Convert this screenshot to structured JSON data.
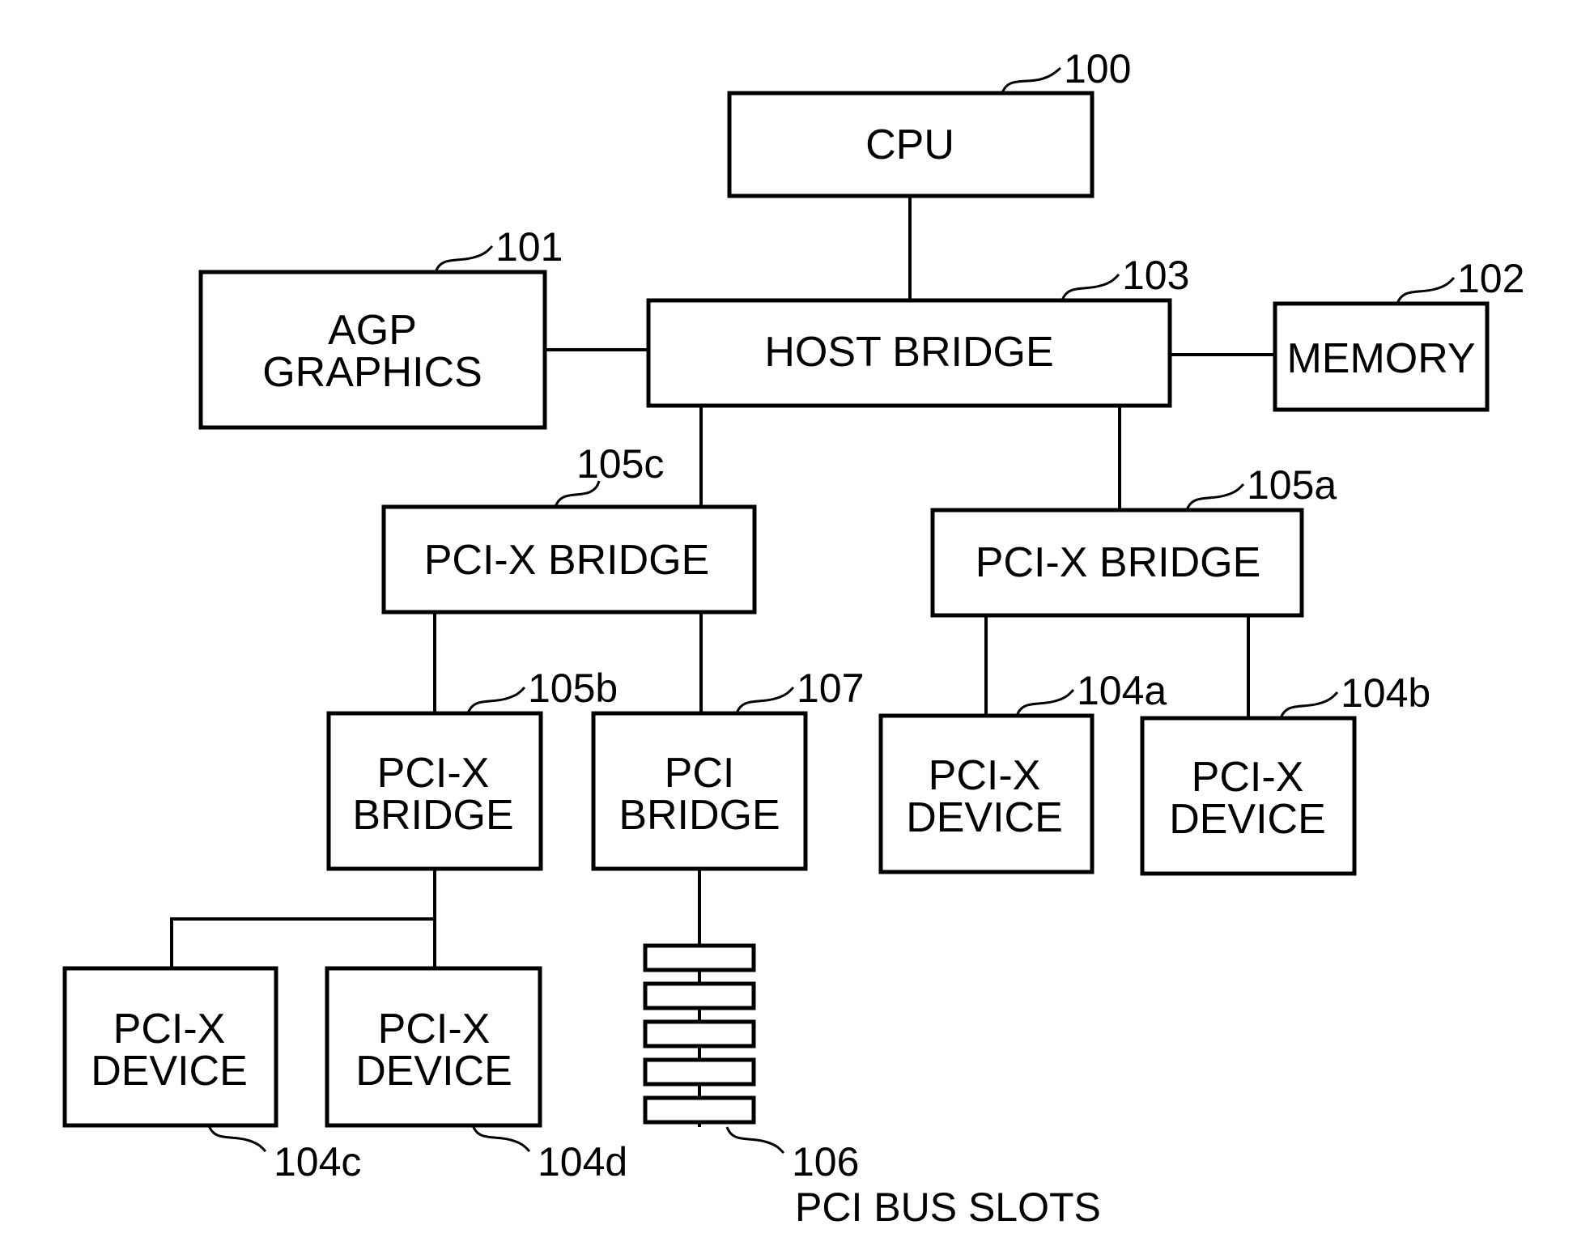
{
  "diagram": {
    "title": "",
    "nodes": {
      "cpu": {
        "ref": "100",
        "lines": [
          "CPU"
        ]
      },
      "agp": {
        "ref": "101",
        "lines": [
          "AGP",
          "GRAPHICS"
        ]
      },
      "memory": {
        "ref": "102",
        "lines": [
          "MEMORY"
        ]
      },
      "host_bridge": {
        "ref": "103",
        "lines": [
          "HOST BRIDGE"
        ]
      },
      "pcix_bridge_a": {
        "ref": "105a",
        "lines": [
          "PCI-X BRIDGE"
        ]
      },
      "pcix_bridge_c": {
        "ref": "105c",
        "lines": [
          "PCI-X BRIDGE"
        ]
      },
      "pcix_bridge_b": {
        "ref": "105b",
        "lines": [
          "PCI-X",
          "BRIDGE"
        ]
      },
      "pci_bridge": {
        "ref": "107",
        "lines": [
          "PCI",
          "BRIDGE"
        ]
      },
      "device_a": {
        "ref": "104a",
        "lines": [
          "PCI-X",
          "DEVICE"
        ]
      },
      "device_b": {
        "ref": "104b",
        "lines": [
          "PCI-X",
          "DEVICE"
        ]
      },
      "device_c": {
        "ref": "104c",
        "lines": [
          "PCI-X",
          "DEVICE"
        ]
      },
      "device_d": {
        "ref": "104d",
        "lines": [
          "PCI-X",
          "DEVICE"
        ]
      },
      "bus_slots": {
        "ref": "106",
        "caption": "PCI BUS SLOTS",
        "slot_count": 5
      }
    },
    "edges": [
      [
        "cpu",
        "host_bridge"
      ],
      [
        "agp",
        "host_bridge"
      ],
      [
        "host_bridge",
        "memory"
      ],
      [
        "host_bridge",
        "pcix_bridge_c"
      ],
      [
        "host_bridge",
        "pcix_bridge_a"
      ],
      [
        "pcix_bridge_c",
        "pcix_bridge_b"
      ],
      [
        "pcix_bridge_c",
        "pci_bridge"
      ],
      [
        "pcix_bridge_a",
        "device_a"
      ],
      [
        "pcix_bridge_a",
        "device_b"
      ],
      [
        "pcix_bridge_b",
        "device_c"
      ],
      [
        "pcix_bridge_b",
        "device_d"
      ],
      [
        "pci_bridge",
        "bus_slots"
      ]
    ]
  }
}
